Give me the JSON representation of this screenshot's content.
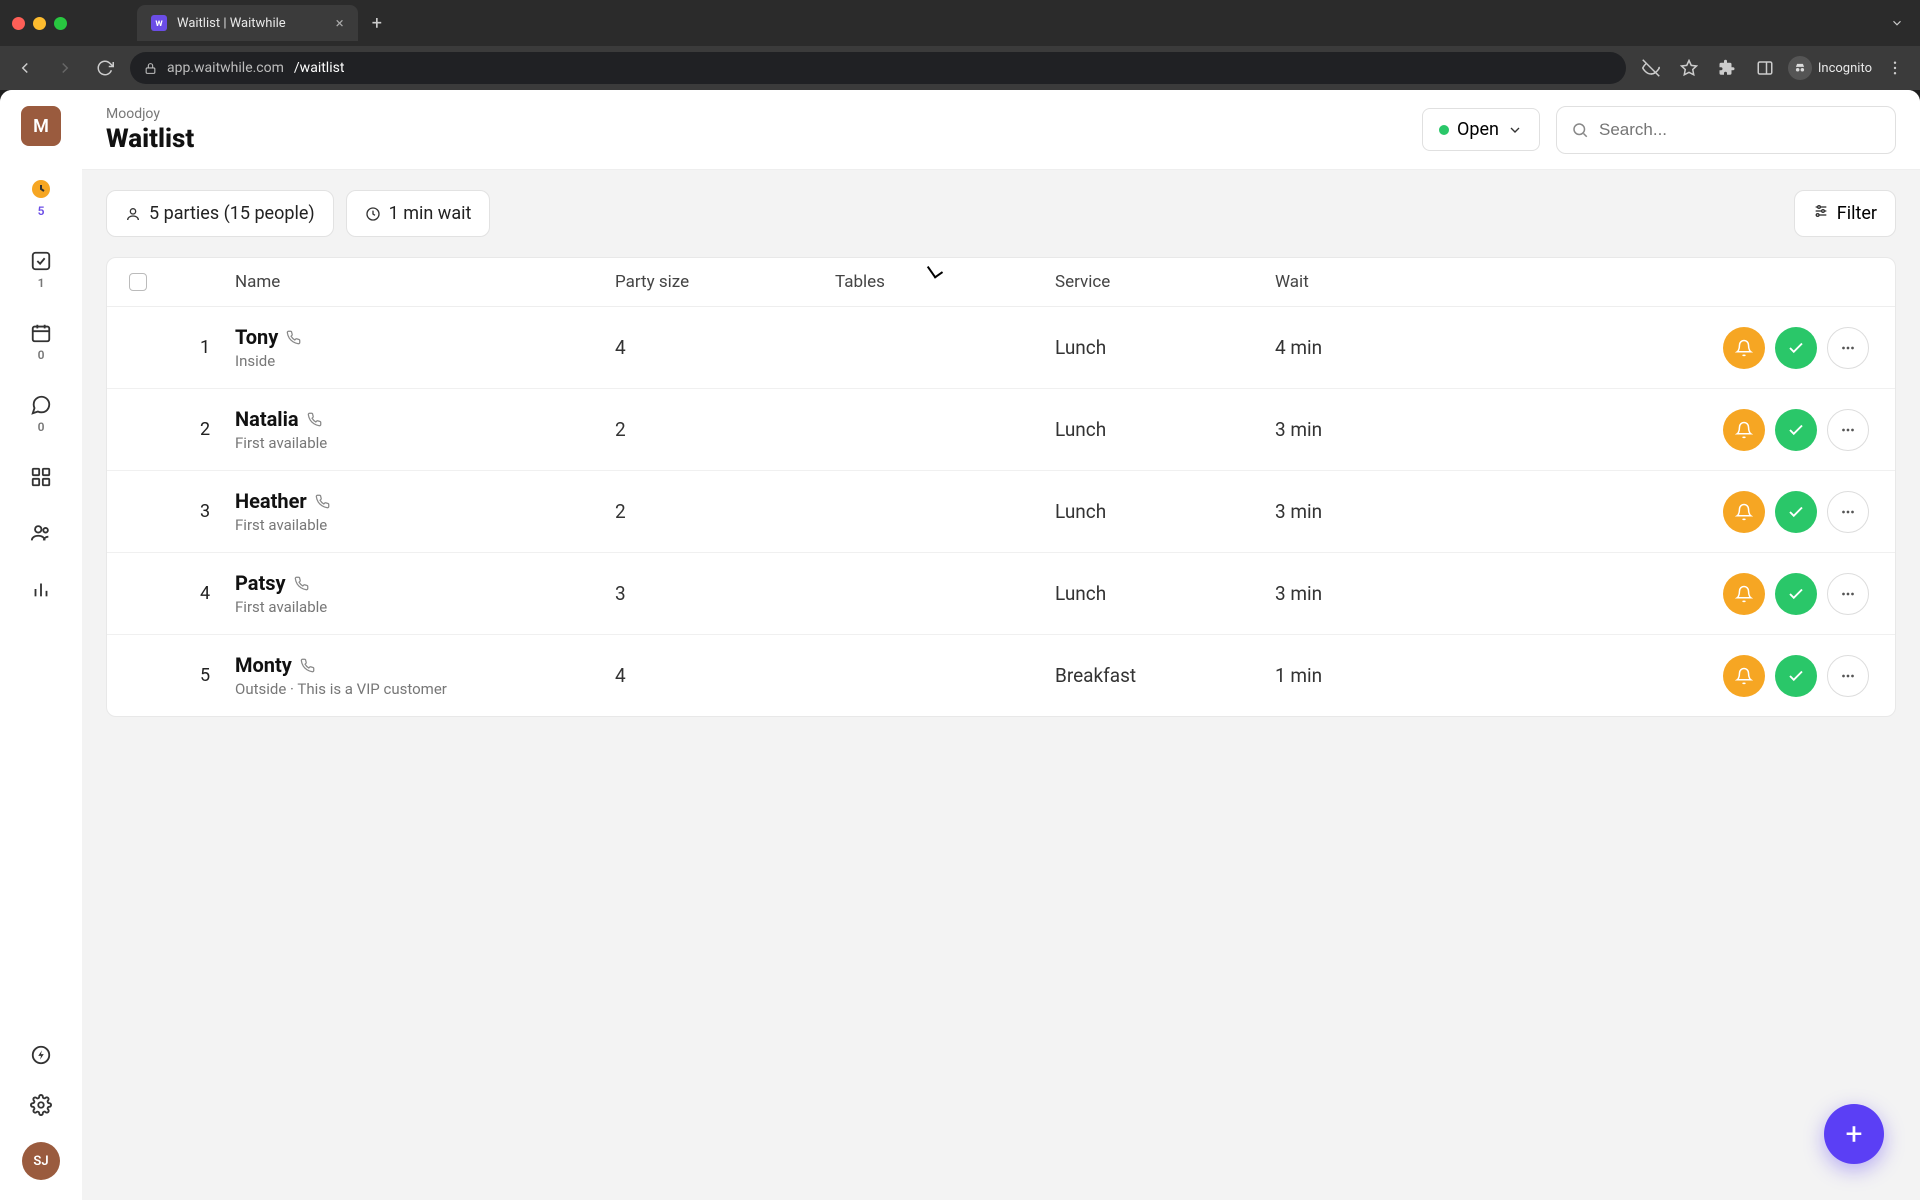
{
  "browser": {
    "tab_title": "Waitlist | Waitwhile",
    "url_host": "app.waitwhile.com",
    "url_path": "/waitlist",
    "incognito_label": "Incognito"
  },
  "sidebar": {
    "org_initial": "M",
    "items": [
      {
        "icon": "clock-icon",
        "count": "5",
        "active": true
      },
      {
        "icon": "check-square-icon",
        "count": "1"
      },
      {
        "icon": "calendar-icon",
        "count": "0"
      },
      {
        "icon": "chat-icon",
        "count": "0"
      },
      {
        "icon": "grid-icon",
        "count": ""
      },
      {
        "icon": "users-icon",
        "count": ""
      },
      {
        "icon": "bar-chart-icon",
        "count": ""
      }
    ],
    "bottom": {
      "bolt": true,
      "settings": true,
      "avatar_initials": "SJ"
    }
  },
  "header": {
    "breadcrumb": "Moodjoy",
    "title": "Waitlist",
    "status_label": "Open",
    "search_placeholder": "Search..."
  },
  "stats": {
    "parties_label": "5 parties (15 people)",
    "wait_label": "1 min wait",
    "filter_label": "Filter"
  },
  "table": {
    "columns": {
      "name": "Name",
      "party_size": "Party size",
      "tables": "Tables",
      "service": "Service",
      "wait": "Wait"
    },
    "rows": [
      {
        "num": "1",
        "name": "Tony",
        "sub": "Inside",
        "party": "4",
        "tables": "",
        "service": "Lunch",
        "wait": "4 min"
      },
      {
        "num": "2",
        "name": "Natalia",
        "sub": "First available",
        "party": "2",
        "tables": "",
        "service": "Lunch",
        "wait": "3 min"
      },
      {
        "num": "3",
        "name": "Heather",
        "sub": "First available",
        "party": "2",
        "tables": "",
        "service": "Lunch",
        "wait": "3 min"
      },
      {
        "num": "4",
        "name": "Patsy",
        "sub": "First available",
        "party": "3",
        "tables": "",
        "service": "Lunch",
        "wait": "3 min"
      },
      {
        "num": "5",
        "name": "Monty",
        "sub": "Outside  · This is a VIP customer",
        "party": "4",
        "tables": "",
        "service": "Breakfast",
        "wait": "1 min"
      }
    ]
  }
}
